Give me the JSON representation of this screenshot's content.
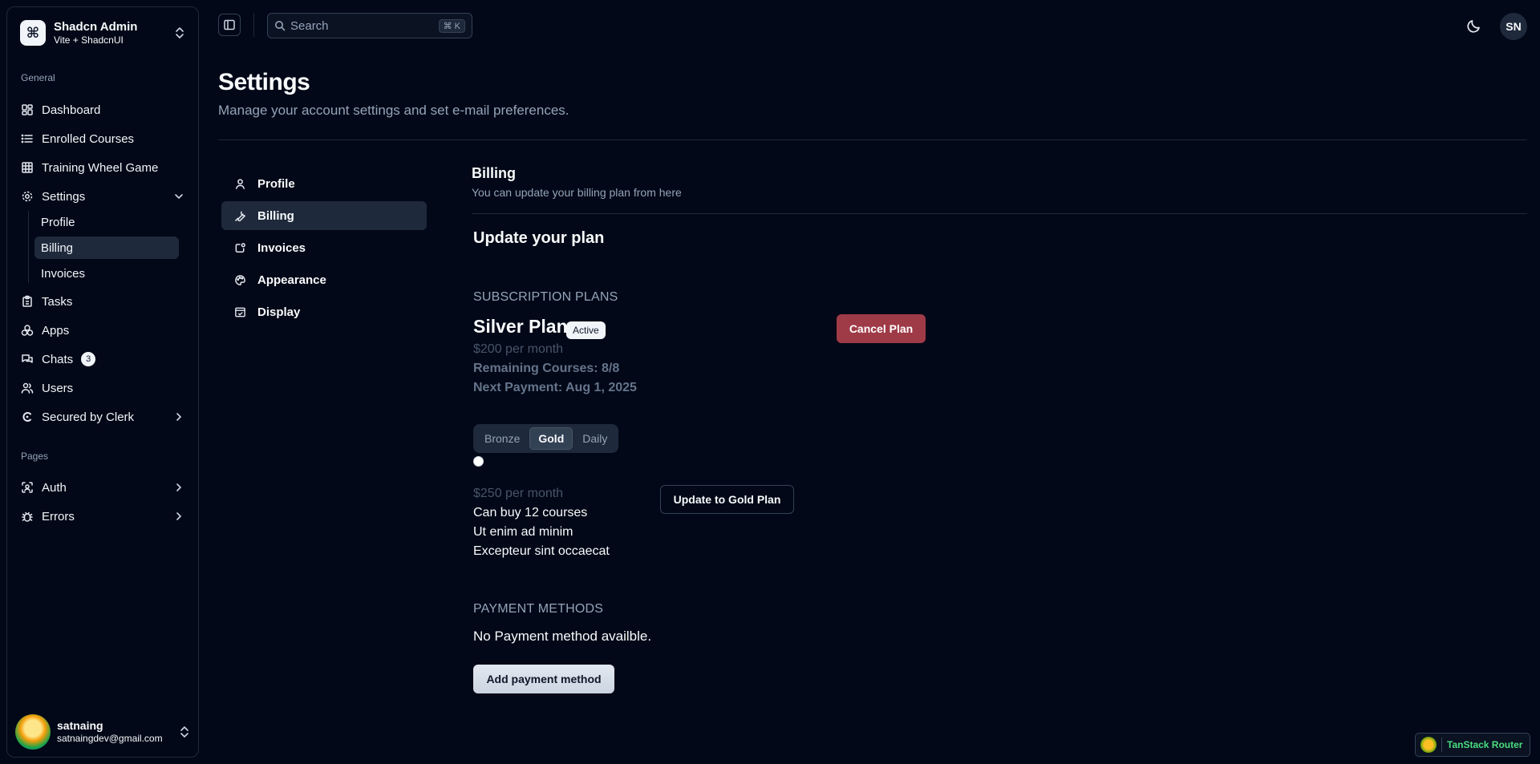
{
  "sidebar": {
    "team_name": "Shadcn Admin",
    "team_plan": "Vite + ShadcnUI",
    "general_label": "General",
    "pages_label": "Pages",
    "items": {
      "dashboard": "Dashboard",
      "enrolled_courses": "Enrolled Courses",
      "training_wheel_game": "Training Wheel Game",
      "settings": "Settings",
      "tasks": "Tasks",
      "apps": "Apps",
      "chats": "Chats",
      "chats_count": "3",
      "users": "Users",
      "secured_by_clerk": "Secured by Clerk",
      "auth": "Auth",
      "errors": "Errors"
    },
    "settings_sub": {
      "profile": "Profile",
      "billing": "Billing",
      "invoices": "Invoices"
    },
    "user": {
      "name": "satnaing",
      "email": "satnaingdev@gmail.com"
    }
  },
  "header": {
    "search_placeholder": "Search",
    "search_kbd": "⌘ K",
    "avatar_initials": "SN"
  },
  "page": {
    "title": "Settings",
    "description": "Manage your account settings and set e-mail preferences."
  },
  "settings_nav": {
    "profile": "Profile",
    "billing": "Billing",
    "invoices": "Invoices",
    "appearance": "Appearance",
    "display": "Display"
  },
  "billing": {
    "title": "Billing",
    "description": "You can update your billing plan from here",
    "update_title": "Update your plan",
    "subscription_label": "SUBSCRIPTION PLANS",
    "current_plan": {
      "name": "Silver Plan",
      "status": "Active",
      "price": "$200 per month",
      "remaining": "Remaining Courses: 8/8",
      "next_payment": "Next Payment: Aug 1, 2025",
      "cancel_label": "Cancel Plan"
    },
    "plan_tabs": [
      "Bronze",
      "Gold",
      "Daily"
    ],
    "selected_tab": "Gold",
    "gold_plan": {
      "price": "$250 per month",
      "features": [
        "Can buy 12 courses",
        "Ut enim ad minim",
        "Excepteur sint occaecat"
      ],
      "upgrade_label": "Update to Gold Plan"
    },
    "payment_label": "PAYMENT METHODS",
    "no_payment_text": "No Payment method availble.",
    "add_payment_label": "Add payment method"
  },
  "devtools": {
    "label": "TanStack Router"
  }
}
